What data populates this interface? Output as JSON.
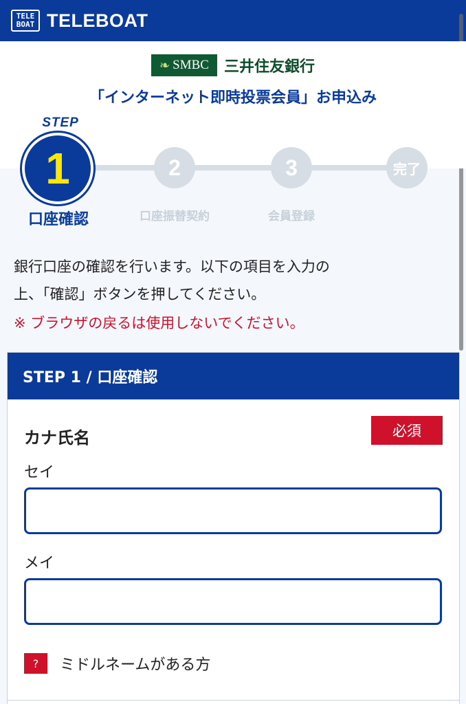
{
  "header": {
    "logo_line1": "TELE",
    "logo_line2": "BOAT",
    "brand": "TELEBOAT"
  },
  "bank": {
    "badge": "SMBC",
    "name": "三井住友銀行"
  },
  "page_title": "「インターネット即時投票会員」お申込み",
  "stepper": {
    "step_word": "STEP",
    "steps": [
      {
        "number": "1",
        "label": "口座確認",
        "active": true
      },
      {
        "number": "2",
        "label": "口座振替契約",
        "active": false
      },
      {
        "number": "3",
        "label": "会員登録",
        "active": false
      },
      {
        "number": "完了",
        "label": "",
        "active": false
      }
    ]
  },
  "instructions": {
    "line1": "銀行口座の確認を行います。以下の項目を入力の",
    "line2": "上、「確認」ボタンを押してください。",
    "warning": "※ ブラウザの戻るは使用しないでください。"
  },
  "form": {
    "section_title": "STEP 1 / 口座確認",
    "kana_name": {
      "title": "カナ氏名",
      "required_badge": "必須",
      "sei_label": "セイ",
      "sei_value": "",
      "mei_label": "メイ",
      "mei_value": ""
    },
    "help_icon": "?",
    "middle_name_text": "ミドルネームがある方"
  },
  "colors": {
    "primary": "#0a3a9a",
    "accent_red": "#d0112b",
    "step_inactive": "#d6dde4",
    "step_number_active": "#ffe600",
    "smbc_green": "#0f5a33"
  }
}
